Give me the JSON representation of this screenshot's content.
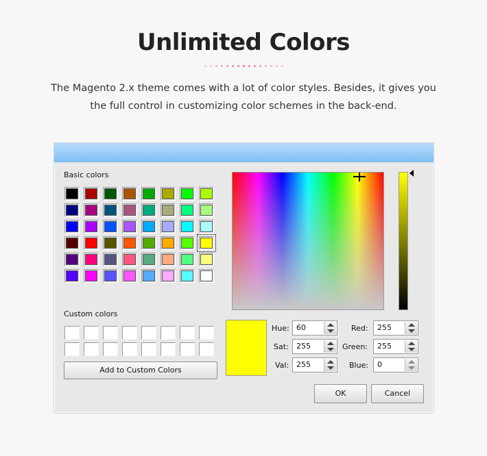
{
  "page": {
    "title": "Unlimited Colors",
    "description": "The Magento 2.x theme comes with a lot of color styles. Besides, it gives you the full control in customizing color schemes in the back-end.",
    "dot_colors": [
      "#f9c6d6",
      "#f8bccf",
      "#f6b0c7",
      "#f4a3be",
      "#f295b4",
      "#f086a9",
      "#ee789f",
      "#ec6b96",
      "#ee789f",
      "#f086a9",
      "#f295b4",
      "#f4a3be",
      "#f6b0c7",
      "#f8bccf",
      "#f9c6d6"
    ]
  },
  "dialog": {
    "basic_colors_label": "Basic colors",
    "custom_colors_label": "Custom colors",
    "add_custom_label": "Add to Custom Colors",
    "ok_label": "OK",
    "cancel_label": "Cancel",
    "basic_colors": [
      "#000000",
      "#aa0000",
      "#005500",
      "#aa5500",
      "#00aa00",
      "#aaaa00",
      "#00ff00",
      "#aaff00",
      "#00007f",
      "#aa007f",
      "#00557f",
      "#aa557f",
      "#00aa7f",
      "#aaaa7f",
      "#00ff7f",
      "#aaff7f",
      "#0000ff",
      "#aa00ff",
      "#0055ff",
      "#aa55ff",
      "#00aaff",
      "#aaaaff",
      "#00ffff",
      "#aaffff",
      "#550000",
      "#ff0000",
      "#555500",
      "#ff5500",
      "#55aa00",
      "#ffaa00",
      "#55ff00",
      "#ffff00",
      "#55007f",
      "#ff007f",
      "#55557f",
      "#ff557f",
      "#55aa7f",
      "#ffaa7f",
      "#55ff7f",
      "#ffff7f",
      "#5500ff",
      "#ff00ff",
      "#5555ff",
      "#ff55ff",
      "#55aaff",
      "#ffaaff",
      "#55ffff",
      "#ffffff"
    ],
    "selected_index": 31,
    "current_color": "#ffff00",
    "fields": {
      "hue": {
        "label": "Hue:",
        "value": "60"
      },
      "sat": {
        "label": "Sat:",
        "value": "255"
      },
      "val": {
        "label": "Val:",
        "value": "255"
      },
      "red": {
        "label": "Red:",
        "value": "255"
      },
      "green": {
        "label": "Green:",
        "value": "255"
      },
      "blue": {
        "label": "Blue:",
        "value": "0"
      }
    }
  }
}
